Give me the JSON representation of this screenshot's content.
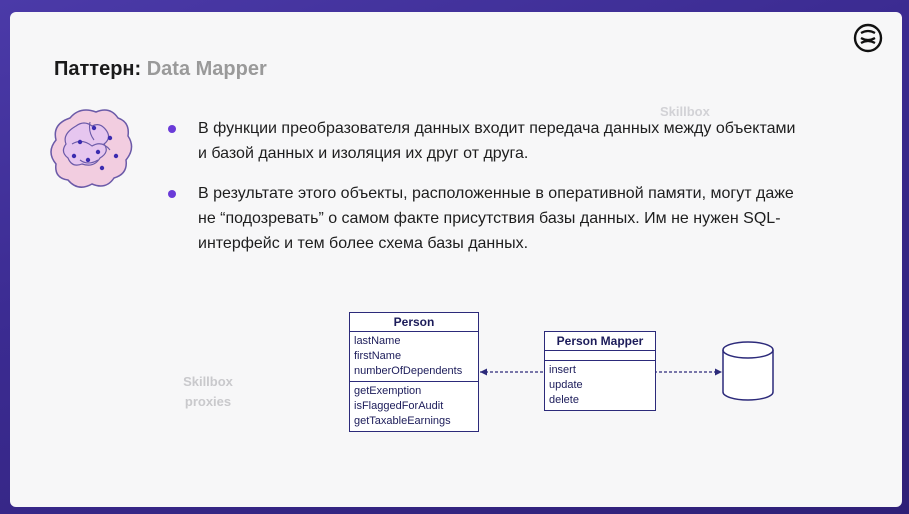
{
  "slide": {
    "title_prefix": "Паттерн:",
    "title_accent": "Data Mapper",
    "bullets": [
      "В функции преобразователя данных входит передача данных между объектами и базой данных и изоляция их друг от друга.",
      "В результате этого объекты, расположенные в оперативной памяти, могут даже не “подозревать” о самом факте присутствия базы данных. Им не нужен SQL-интерфейс и тем более схема базы данных."
    ],
    "watermarks": [
      "Skillbox",
      "Skillbox proxies"
    ],
    "icons": {
      "logo": "skillbox-brain-logo-icon",
      "illustration": "brain-network-icon",
      "database": "database-cylinder-icon"
    },
    "colors": {
      "bullet": "#6a3bd8",
      "uml": "#2c2a7a",
      "slide_bg": "#f7f7f8"
    }
  },
  "diagram": {
    "person": {
      "name": "Person",
      "fields": [
        "lastName",
        "firstName",
        "numberOfDependents"
      ],
      "methods": [
        "getExemption",
        "isFlaggedForAudit",
        "getTaxableEarnings"
      ]
    },
    "mapper": {
      "name": "Person Mapper",
      "methods": [
        "insert",
        "update",
        "delete"
      ]
    }
  }
}
